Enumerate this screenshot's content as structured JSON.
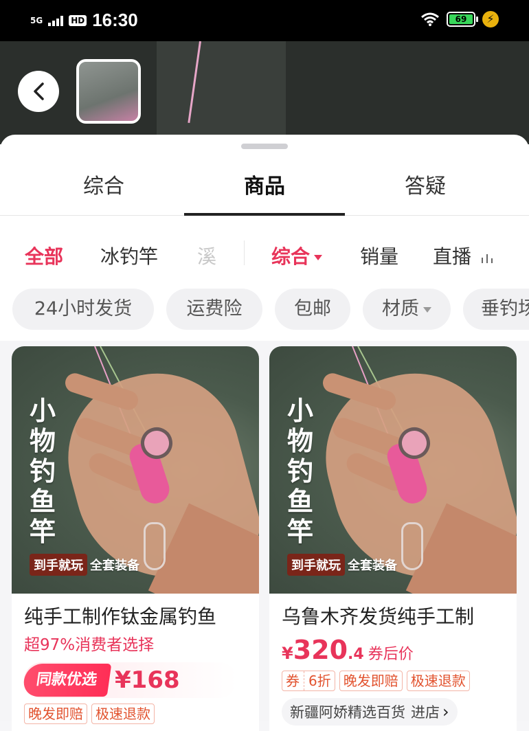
{
  "status_bar": {
    "network": "5G",
    "hd": "HD",
    "time": "16:30",
    "battery": "69"
  },
  "tabs": [
    {
      "label": "综合"
    },
    {
      "label": "商品"
    },
    {
      "label": "答疑"
    }
  ],
  "filters": {
    "categories": [
      "全部",
      "冰钓竿",
      "溪"
    ],
    "sorts": [
      "综合",
      "销量",
      "直播"
    ]
  },
  "chips": [
    "24小时发货",
    "运费险",
    "包邮",
    "材质",
    "垂钓场"
  ],
  "products": [
    {
      "image_title_chars": [
        "小",
        "物",
        "钓",
        "鱼",
        "竿"
      ],
      "image_tag_a": "到手就玩",
      "image_tag_b": "全套装备",
      "title": "纯手工制作钛金属钓鱼",
      "subtitle": "超97%消费者选择",
      "promo_badge": "同款优选",
      "promo_price": "¥168",
      "tags": [
        "晚发即赔",
        "极速退款"
      ]
    },
    {
      "image_title_chars": [
        "小",
        "物",
        "钓",
        "鱼",
        "竿"
      ],
      "image_tag_a": "到手就玩",
      "image_tag_b": "全套装备",
      "title": "乌鲁木齐发货纯手工制",
      "price_yen": "¥",
      "price_int": "320",
      "price_dec": ".4",
      "price_note": "券后价",
      "coupon_label": "券",
      "coupon_value": "6折",
      "tags": [
        "晚发即赔",
        "极速退款"
      ],
      "store": "新疆阿娇精选百货",
      "store_action": "进店"
    }
  ]
}
